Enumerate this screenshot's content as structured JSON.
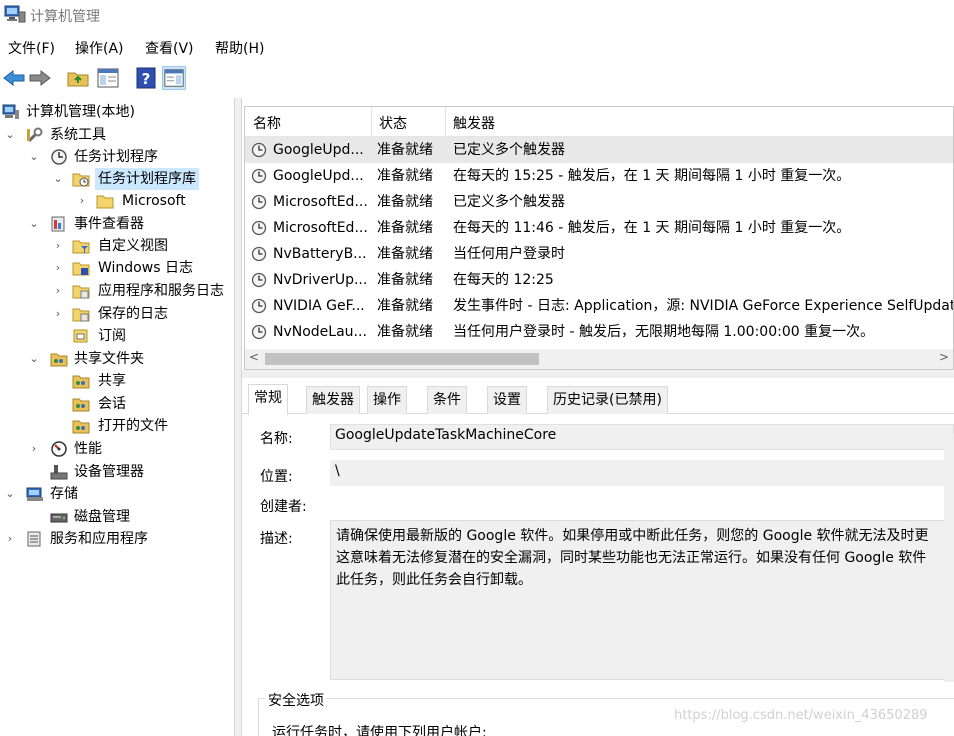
{
  "window": {
    "title": "计算机管理"
  },
  "menu": [
    "文件(F)",
    "操作(A)",
    "查看(V)",
    "帮助(H)"
  ],
  "toolbar": {
    "icons": [
      "back-arrow-icon",
      "forward-arrow-icon",
      "up-folder-icon",
      "show-hide-tree-icon",
      "help-icon",
      "action-pane-icon"
    ]
  },
  "tree": {
    "root": "计算机管理(本地)",
    "system_tools": "系统工具",
    "task_scheduler": "任务计划程序",
    "task_scheduler_library": "任务计划程序库",
    "microsoft": "Microsoft",
    "event_viewer": "事件查看器",
    "custom_views": "自定义视图",
    "windows_logs": "Windows 日志",
    "app_service_logs": "应用程序和服务日志",
    "saved_logs": "保存的日志",
    "subscriptions": "订阅",
    "shared_folders": "共享文件夹",
    "shares": "共享",
    "sessions": "会话",
    "open_files": "打开的文件",
    "performance": "性能",
    "device_manager": "设备管理器",
    "storage": "存储",
    "disk_management": "磁盘管理",
    "services_apps": "服务和应用程序"
  },
  "list": {
    "columns": [
      "名称",
      "状态",
      "触发器"
    ],
    "rows": [
      {
        "name": "GoogleUpd...",
        "status": "准备就绪",
        "trigger": "已定义多个触发器"
      },
      {
        "name": "GoogleUpd...",
        "status": "准备就绪",
        "trigger": "在每天的 15:25 - 触发后，在 1 天 期间每隔 1 小时 重复一次。"
      },
      {
        "name": "MicrosoftEd...",
        "status": "准备就绪",
        "trigger": "已定义多个触发器"
      },
      {
        "name": "MicrosoftEd...",
        "status": "准备就绪",
        "trigger": "在每天的 11:46 - 触发后，在 1 天 期间每隔 1 小时 重复一次。"
      },
      {
        "name": "NvBatteryB...",
        "status": "准备就绪",
        "trigger": "当任何用户登录时"
      },
      {
        "name": "NvDriverUp...",
        "status": "准备就绪",
        "trigger": "在每天的 12:25"
      },
      {
        "name": "NVIDIA GeF...",
        "status": "准备就绪",
        "trigger": "发生事件时 - 日志: Application，源: NVIDIA GeForce Experience SelfUpdat"
      },
      {
        "name": "NvNodeLau...",
        "status": "准备就绪",
        "trigger": "当任何用户登录时 - 触发后，无限期地每隔 1.00:00:00 重复一次。"
      }
    ],
    "scroll_left": "<",
    "scroll_right": ">"
  },
  "detail": {
    "tabs": [
      "常规",
      "触发器",
      "操作",
      "条件",
      "设置",
      "历史记录(已禁用)"
    ],
    "name_label": "名称:",
    "name_value": "GoogleUpdateTaskMachineCore",
    "location_label": "位置:",
    "location_value": "\\",
    "author_label": "创建者:",
    "desc_label": "描述:",
    "desc_lines": [
      "请确保使用最新版的 Google 软件。如果停用或中断此任务，则您的 Google 软件就无法及时更",
      "这意味着无法修复潜在的安全漏洞，同时某些功能也无法正常运行。如果没有任何 Google 软件",
      "此任务，则此任务会自行卸载。"
    ],
    "security_title": "安全选项",
    "runas_text": "运行任务时，请使用下列用户帐户:"
  },
  "watermark": "https://blog.csdn.net/weixin_43650289"
}
